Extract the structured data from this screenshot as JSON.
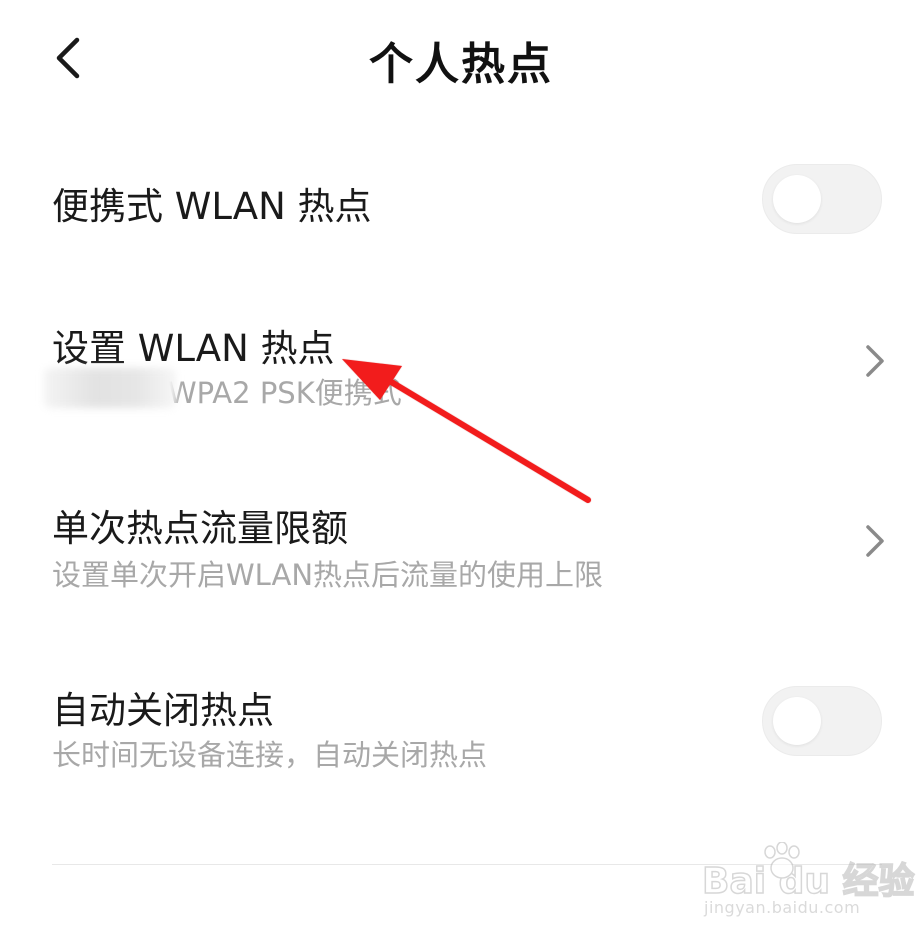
{
  "header": {
    "title": "个人热点",
    "back_icon": "chevron-left-icon"
  },
  "settings": [
    {
      "id": "portable-hotspot",
      "title": "便携式 WLAN 热点",
      "control": "toggle",
      "enabled": false
    },
    {
      "id": "setup-hotspot",
      "title": "设置 WLAN 热点",
      "subtitle": "WPA2 PSK便携式",
      "control": "chevron",
      "subtitle_prefix_obscured": true
    },
    {
      "id": "data-limit",
      "title": "单次热点流量限额",
      "subtitle": "设置单次开启WLAN热点后流量的使用上限",
      "control": "chevron"
    },
    {
      "id": "auto-off",
      "title": "自动关闭热点",
      "subtitle": "长时间无设备连接，自动关闭热点",
      "control": "toggle",
      "enabled": false
    }
  ],
  "annotation": {
    "type": "arrow",
    "color": "#f21d1d",
    "points_to": "setup-hotspot"
  },
  "watermark": {
    "logo": "Bai du 经验",
    "url": "jingyan.baidu.com"
  },
  "colors": {
    "background": "#ffffff",
    "primary_text": "#1a1a1a",
    "secondary_text": "#a8a8a8",
    "toggle_off_track": "#f2f2f2",
    "chevron": "#8a8a8a",
    "divider": "#e8e8e8"
  }
}
